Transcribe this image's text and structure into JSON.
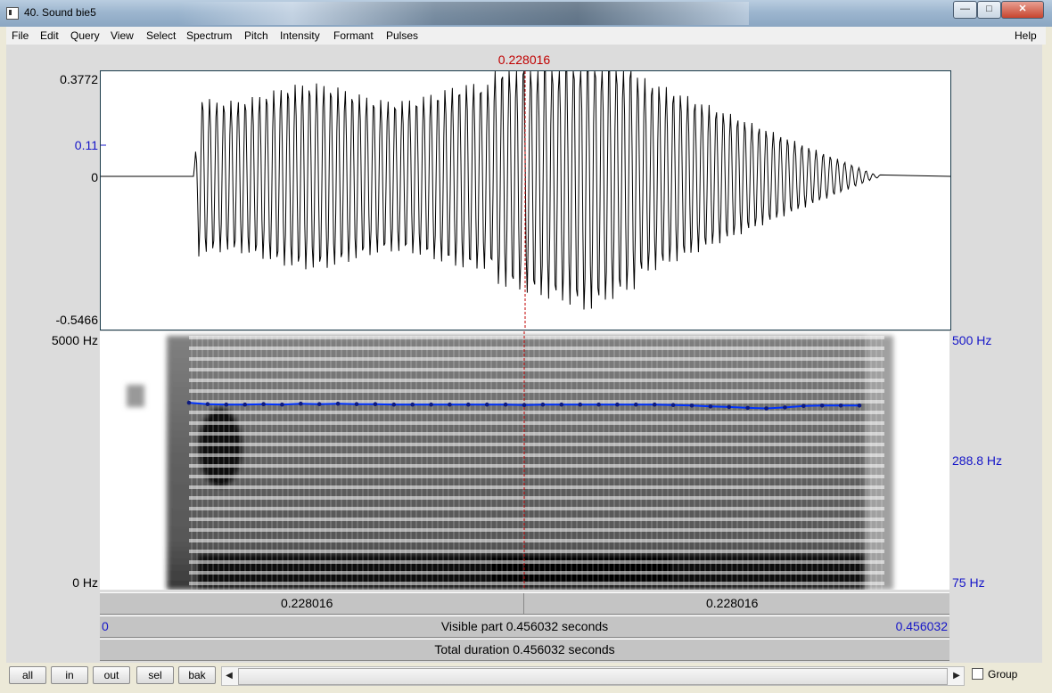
{
  "window": {
    "title": "40. Sound bie5",
    "minimize": "—",
    "maximize": "□",
    "close": "✕"
  },
  "menu": [
    "File",
    "Edit",
    "Query",
    "View",
    "Select",
    "Spectrum",
    "Pitch",
    "Intensity",
    "Formant",
    "Pulses"
  ],
  "help": "Help",
  "cursor_time": "0.228016",
  "wave": {
    "ymax": "0.3772",
    "ymid": "0.11",
    "yzero": "0",
    "ymin": "-0.5466"
  },
  "spectrogram": {
    "top": "5000 Hz",
    "bottom": "0 Hz"
  },
  "pitch": {
    "top": "500 Hz",
    "mid": "288.8 Hz",
    "bottom": "75 Hz",
    "color": "#0033ff",
    "values_hz": [
      296,
      293,
      292,
      292,
      293,
      292,
      294,
      293,
      294,
      293,
      293,
      292,
      292,
      292,
      292,
      292,
      292,
      292,
      291,
      292,
      292,
      292,
      292,
      292,
      292,
      292,
      291,
      290,
      288,
      287,
      285,
      284,
      286,
      289,
      290,
      290,
      290
    ]
  },
  "bars": {
    "left_seg": "0.228016",
    "right_seg": "0.228016",
    "start": "0",
    "end": "0.456032",
    "visible": "Visible part 0.456032 seconds",
    "total": "Total duration 0.456032 seconds"
  },
  "buttons": {
    "all": "all",
    "in": "in",
    "out": "out",
    "sel": "sel",
    "bak": "bak"
  },
  "scroll": {
    "left": "◀",
    "right": "▶"
  },
  "group": "Group"
}
